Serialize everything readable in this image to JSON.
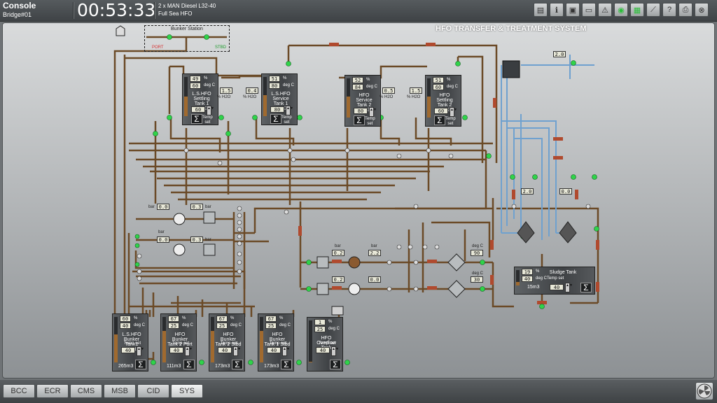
{
  "header": {
    "console_title": "Console",
    "station": "Bridge#01",
    "clock": "00:53:33",
    "engine_line1": "2 x MAN Diesel L32-40",
    "engine_line2": "Full Sea HFO",
    "toolbar_icons": [
      "dock-icon",
      "info-icon",
      "save-icon",
      "monitor-icon",
      "alarm-icon",
      "eye-icon",
      "document-icon",
      "trend-icon",
      "help-icon",
      "print-icon",
      "exit-icon"
    ]
  },
  "diagram": {
    "title": "HFO TRANSFER & TREATMENT SYSTEM",
    "bunker_station": {
      "title": "Bunker Station",
      "port": "PORT",
      "stbd": "STBD"
    },
    "colors": {
      "pipe": "#6b4a27",
      "water": "#6fa1cf",
      "valve_open": "#2fd34a",
      "hfo": "#a06a2f"
    },
    "top_tanks": [
      {
        "name": "L.S.HFO\nSettling Tank 1\n50m3",
        "level": "49",
        "level_unit": "%",
        "temp": "60",
        "temp_unit": "deg C",
        "temp_set": "60",
        "temp_label": "Temp\nset",
        "fill": 0.49,
        "water": "1.5",
        "water_unit": "% H2O"
      },
      {
        "name": "L.S.HFO\nService Tank 1\n14m3",
        "level": "51",
        "level_unit": "%",
        "temp": "80",
        "temp_unit": "deg C",
        "temp_set": "80",
        "temp_label": "Temp\nset",
        "fill": 0.51,
        "water": "0.4",
        "water_unit": "% H2O"
      },
      {
        "name": "HFO Service\nTank 2\n50m3",
        "level": "52",
        "level_unit": "%",
        "temp": "84",
        "temp_unit": "deg C",
        "temp_set": "80",
        "temp_label": "Temp\nset",
        "fill": 0.52,
        "water": "0.5",
        "water_unit": "% H2O"
      },
      {
        "name": "HFO Settling\nTank 2\n14m3",
        "level": "51",
        "level_unit": "%",
        "temp": "60",
        "temp_unit": "deg C",
        "temp_set": "60",
        "temp_label": "Temp\nset",
        "fill": 0.51,
        "water": "1.5",
        "water_unit": "% H2O"
      }
    ],
    "bottom_tanks": [
      {
        "name": "L.S.HFO\nBunker Tank1\nPort",
        "level": "60",
        "level_unit": "%",
        "temp": "40",
        "temp_unit": "deg C",
        "temp_label": "Temp set",
        "temp_set": "40",
        "volume": "265m3",
        "fill": 0.6
      },
      {
        "name": "HFO Bunker\nTank 2 Port",
        "level": "67",
        "level_unit": "%",
        "temp": "25",
        "temp_unit": "deg C",
        "temp_label": "Temp set",
        "temp_set": "40",
        "volume": "111m3",
        "fill": 0.67
      },
      {
        "name": "HFO Bunker\nTank 2 Stbd",
        "level": "67",
        "level_unit": "%",
        "temp": "25",
        "temp_unit": "deg C",
        "temp_label": "Temp set",
        "temp_set": "40",
        "volume": "173m3",
        "fill": 0.67
      },
      {
        "name": "HFO Bunker\nTank 1 Stbd",
        "level": "67",
        "level_unit": "%",
        "temp": "25",
        "temp_unit": "deg C",
        "temp_label": "Temp set",
        "temp_set": "40",
        "volume": "173m3",
        "fill": 0.67
      },
      {
        "name": "HFO\nOverflow\nTank",
        "level": "1",
        "level_unit": "%",
        "temp": "25",
        "temp_unit": "deg C",
        "temp_label": "Temp set",
        "temp_set": "40",
        "volume": "",
        "fill": 0.01
      }
    ],
    "sludge_tank": {
      "name": "Sludge Tank",
      "level": "19",
      "level_unit": "%",
      "temp": "40",
      "temp_unit": "deg C",
      "temp_label": "Temp set",
      "temp_set": "40",
      "volume": "15m3",
      "fill": 0.19
    },
    "transfer_pumps": [
      {
        "suction_label": "bar",
        "suction": "0.0",
        "discharge": "0.3",
        "discharge_label": "bar"
      },
      {
        "suction_label": "bar",
        "suction": "0.0",
        "discharge": "0.3",
        "discharge_label": "bar"
      }
    ],
    "separator_pumps": [
      {
        "suction_label": "bar",
        "suction": "0.2",
        "discharge_label": "bar",
        "discharge": "2.2",
        "temp_label": "deg C",
        "temp": "90"
      },
      {
        "suction_label": "",
        "suction": "0.2",
        "discharge_label": "",
        "discharge": "0.0",
        "temp_label": "deg C",
        "temp": "30"
      }
    ],
    "water_pressure": "2.0",
    "separator_water": [
      "2.0",
      "0.0"
    ]
  },
  "bottom_tabs": [
    "BCC",
    "ECR",
    "CMS",
    "MSB",
    "CID",
    "SYS"
  ],
  "active_tab": "SYS"
}
